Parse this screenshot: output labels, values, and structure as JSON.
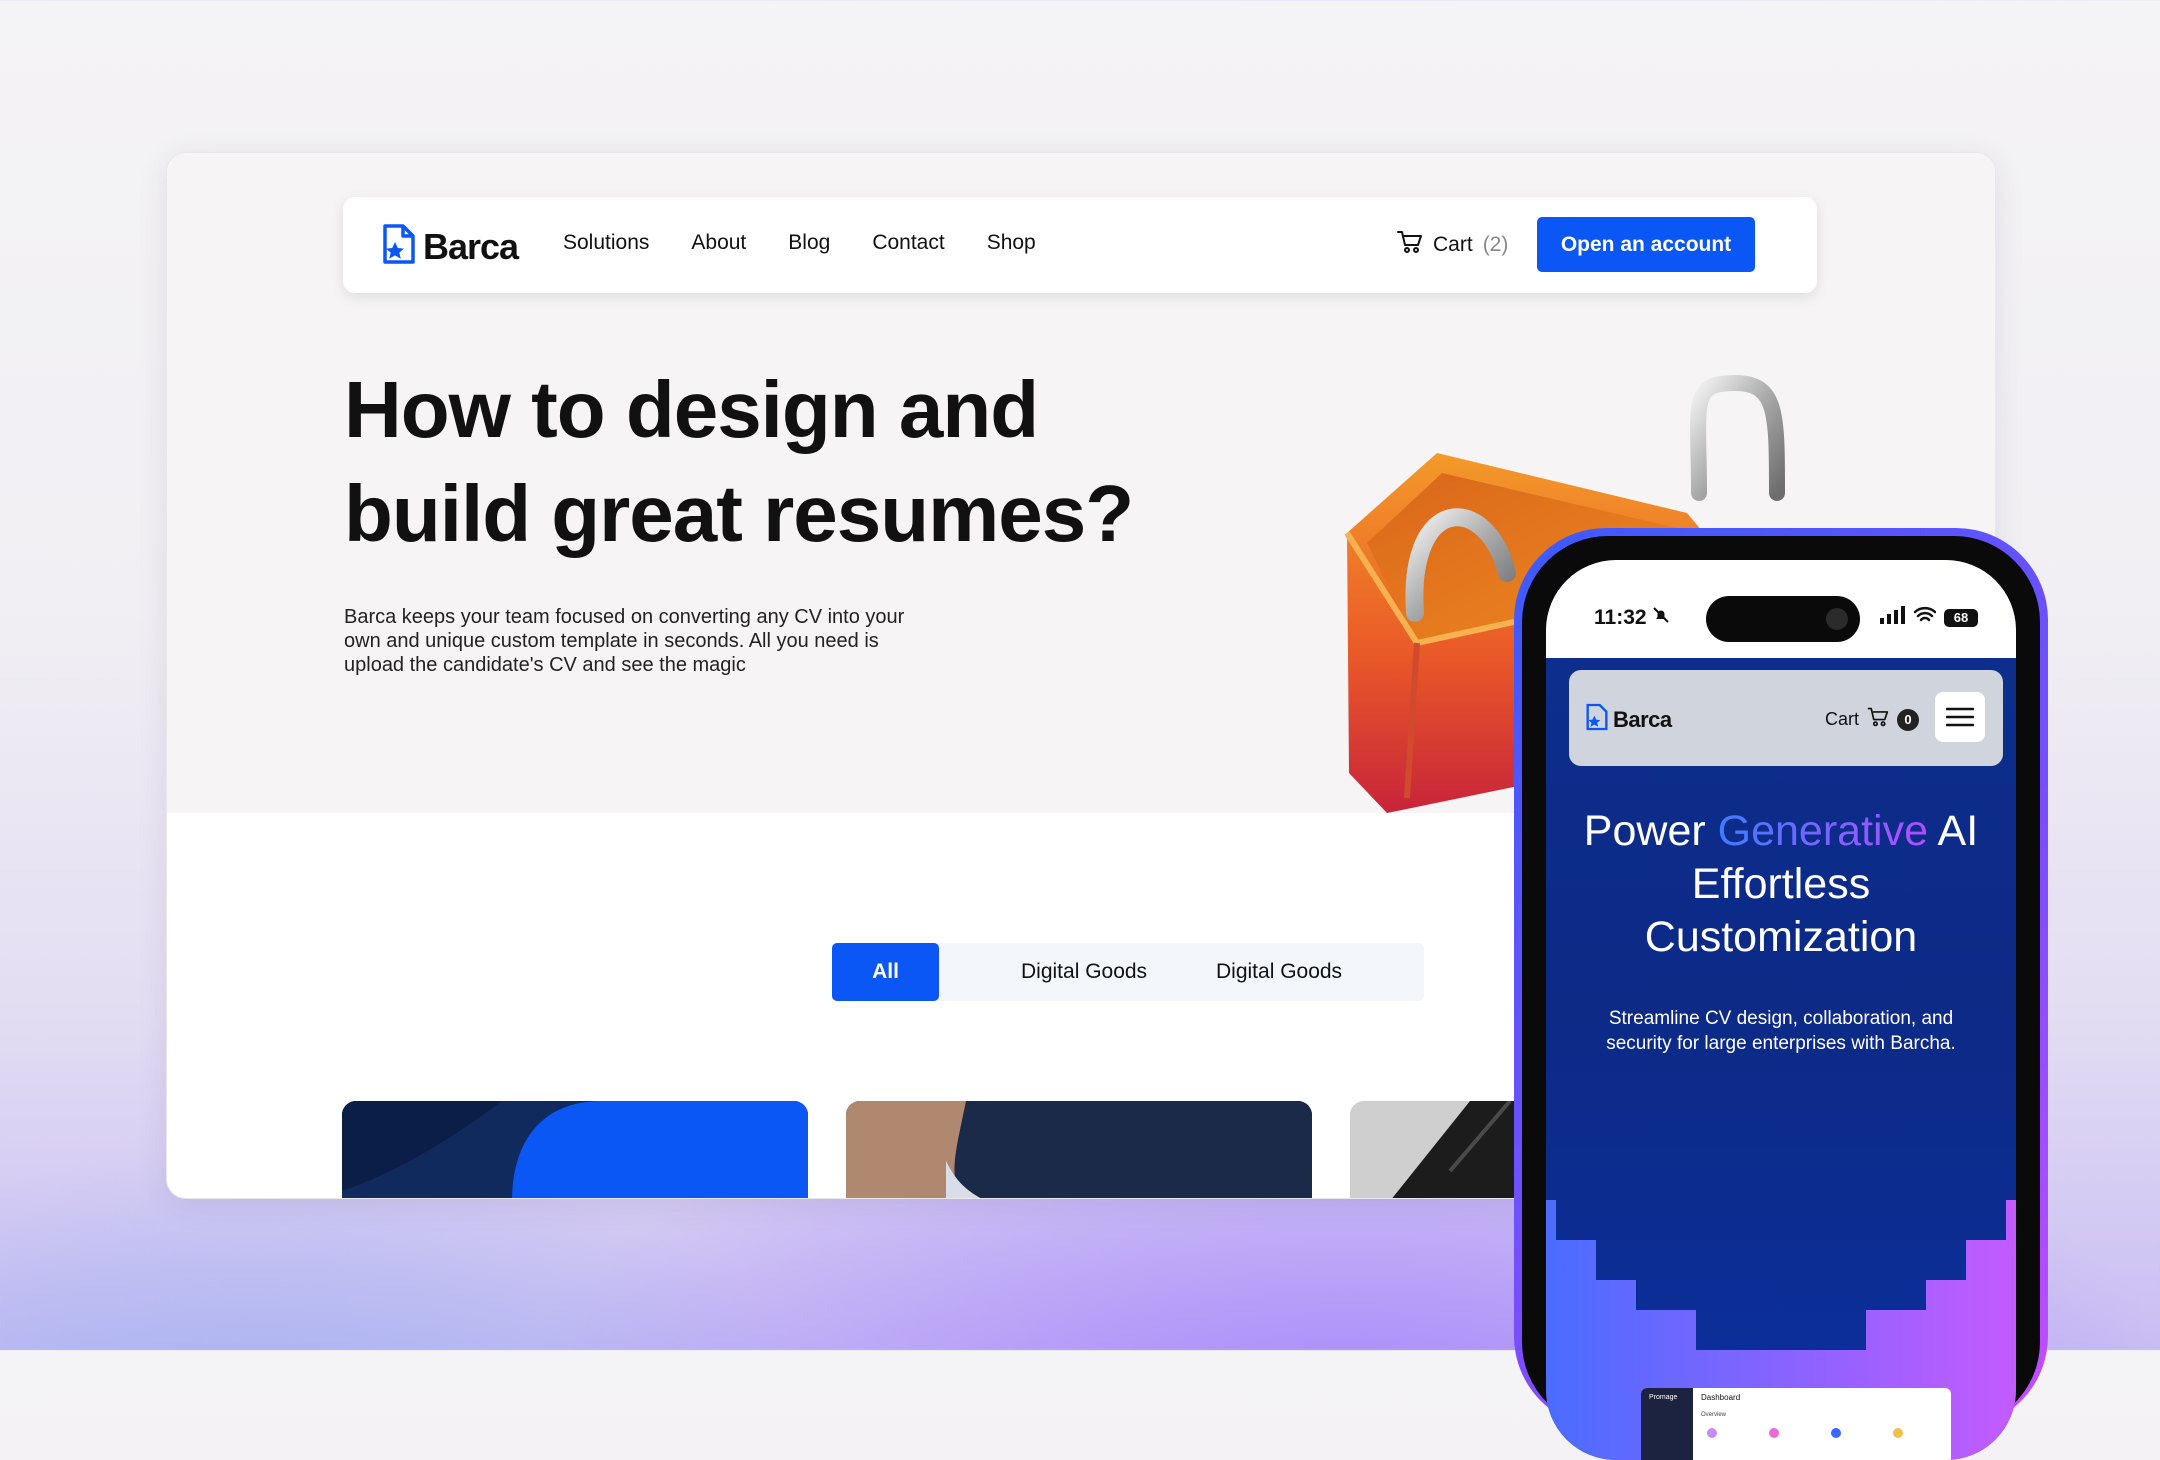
{
  "browser": {
    "nav": {
      "logo": "Barca",
      "menu": [
        "Solutions",
        "About",
        "Blog",
        "Contact",
        "Shop"
      ],
      "cart_label": "Cart",
      "cart_count": "(2)",
      "cta": "Open an account"
    },
    "hero": {
      "title_line1": "How to design and",
      "title_line2": "build great resumes?",
      "lead": "Barca keeps your team focused on converting any CV into your own and unique custom template in seconds. All you need is upload the candidate's CV and see the magic"
    },
    "filters": {
      "tabs": [
        "All",
        "Digital Goods",
        "Digital Goods"
      ]
    }
  },
  "phone": {
    "time": "11:32",
    "battery": "68",
    "logo": "Barca",
    "cart_label": "Cart",
    "cart_count": "0",
    "heading_pre": "Power ",
    "heading_gradient": "Generative",
    "heading_post": " AI",
    "heading_line2": "Effortless",
    "heading_line3": "Customization",
    "subtext": "Streamline CV design, collaboration, and security for large enterprises with Barcha.",
    "dashboard_title": "Dashboard",
    "dashboard_sub": "Overview",
    "dashboard_brand": "Promage"
  },
  "colors": {
    "accent": "#0b57f5",
    "phone_bg": "#0e2f8f",
    "frame_gradient_start": "#3b5bff",
    "frame_gradient_end": "#c64dff"
  },
  "icons": [
    "barca-logo-icon",
    "cart-icon",
    "menu-hamburger-icon",
    "bell-slash-icon",
    "signal-icon",
    "wifi-icon",
    "battery-icon",
    "shopping-bag-illustration"
  ]
}
